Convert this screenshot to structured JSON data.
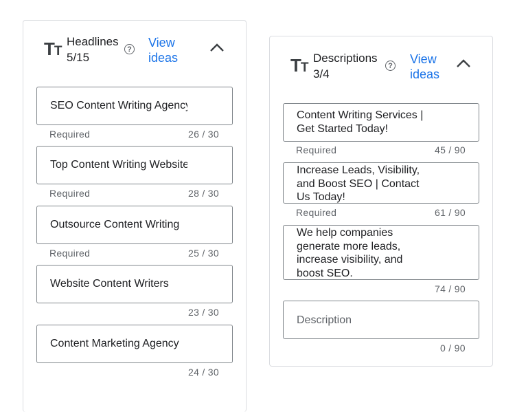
{
  "headlines": {
    "title": "Headlines",
    "count": "5/15",
    "view_ideas": "View ideas",
    "items": [
      {
        "value": "SEO Content Writing Agency",
        "required": "Required",
        "counter": "26 / 30"
      },
      {
        "value": "Top Content Writing Website",
        "required": "Required",
        "counter": "28 / 30"
      },
      {
        "value": "Outsource Content Writing",
        "required": "Required",
        "counter": "25 / 30"
      },
      {
        "value": "Website Content Writers",
        "required": "",
        "counter": "23 / 30"
      },
      {
        "value": "Content Marketing Agency",
        "required": "",
        "counter": "24 / 30"
      }
    ]
  },
  "descriptions": {
    "title": "Descriptions",
    "count": "3/4",
    "view_ideas": "View ideas",
    "items": [
      {
        "value": "Content Writing Services |\nGet Started Today!",
        "required": "Required",
        "counter": "45 / 90"
      },
      {
        "value": "Increase Leads, Visibility,\nand Boost SEO | Contact\nUs Today!",
        "required": "Required",
        "counter": "61 / 90"
      },
      {
        "value": "We help companies\ngenerate more leads,\nincrease visibility, and\nboost SEO.",
        "required": "",
        "counter": "74 / 90"
      },
      {
        "value": "",
        "placeholder": "Description",
        "required": "",
        "counter": "0 / 90"
      }
    ]
  },
  "icons": {
    "text_format": "text-format-icon",
    "help": "help-icon",
    "collapse": "chevron-up-icon"
  },
  "colors": {
    "link": "#1a73e8",
    "border": "#80868b",
    "muted_text": "#5f6368"
  }
}
